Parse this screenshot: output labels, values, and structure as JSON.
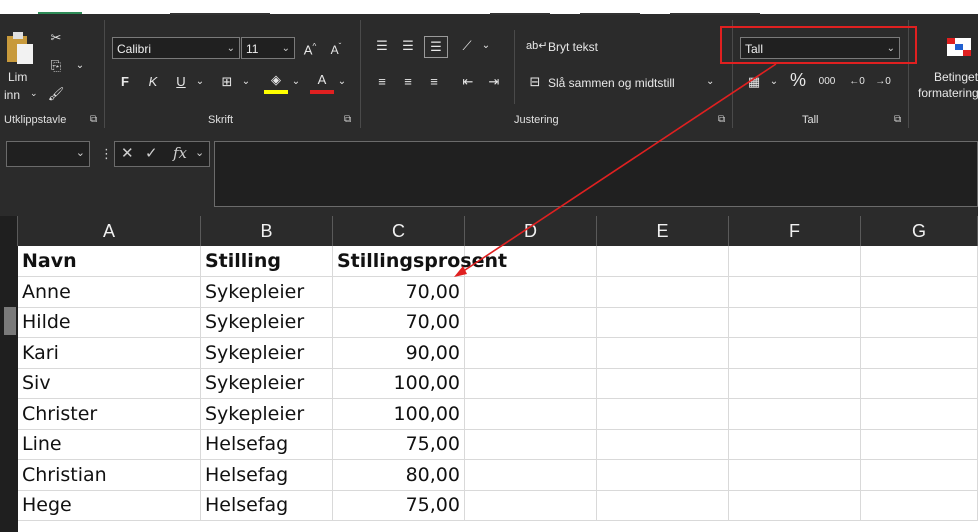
{
  "ribbon": {
    "clipboard": {
      "paste_label_1": "Lim",
      "paste_label_2": "inn",
      "group_label": "Utklippstavle"
    },
    "font": {
      "font_name": "Calibri",
      "font_size": "11",
      "bold": "F",
      "italic": "K",
      "underline": "U",
      "group_label": "Skrift"
    },
    "alignment": {
      "wrap_text": "Bryt tekst",
      "merge_center": "Slå sammen og midtstill",
      "group_label": "Justering"
    },
    "number": {
      "format_value": "Tall",
      "percent": "%",
      "thousands": "000",
      "group_label": "Tall"
    },
    "styles": {
      "conditional_1": "Betinget",
      "conditional_2": "formatering"
    }
  },
  "formula_bar": {
    "fx_label": "fx"
  },
  "columns": [
    "A",
    "B",
    "C",
    "D",
    "E",
    "F",
    "G"
  ],
  "table": {
    "headers": [
      "Navn",
      "Stilling",
      "Stillingsprosent"
    ],
    "rows": [
      [
        "Anne",
        "Sykepleier",
        "70,00"
      ],
      [
        "Hilde",
        "Sykepleier",
        "70,00"
      ],
      [
        "Kari",
        "Sykepleier",
        "90,00"
      ],
      [
        "Siv",
        "Sykepleier",
        "100,00"
      ],
      [
        "Christer",
        "Sykepleier",
        "100,00"
      ],
      [
        "Line",
        "Helsefag",
        "75,00"
      ],
      [
        "Christian",
        "Helsefag",
        "80,00"
      ],
      [
        "Hege",
        "Helsefag",
        "75,00"
      ]
    ]
  },
  "colors": {
    "annotation": "#e02020",
    "ribbon_bg": "#2b2b2b"
  }
}
